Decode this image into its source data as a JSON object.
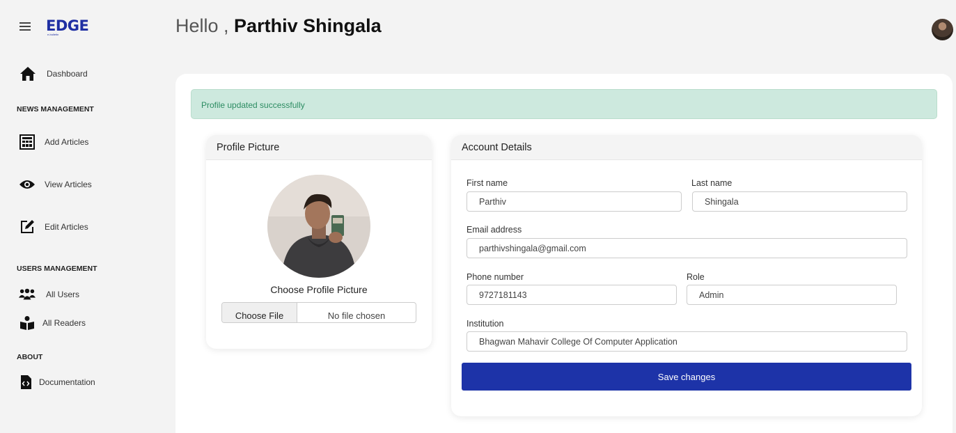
{
  "header": {
    "greeting_prefix": "Hello ,",
    "user_name": "Parthiv Shingala"
  },
  "logo": {
    "text": "EDGE",
    "subtext": "e-bulletin"
  },
  "sidebar": {
    "dashboard": {
      "label": "Dashboard",
      "icon": "home-icon"
    },
    "sections": [
      {
        "title": "NEWS MANAGEMENT"
      },
      {
        "title": "USERS MANAGEMENT"
      },
      {
        "title": "ABOUT"
      }
    ],
    "items": [
      {
        "label": "Add Articles",
        "icon": "newspaper-icon"
      },
      {
        "label": "View Articles",
        "icon": "eye-icon"
      },
      {
        "label": "Edit Articles",
        "icon": "edit-icon"
      },
      {
        "label": "All Users",
        "icon": "users-icon"
      },
      {
        "label": "All Readers",
        "icon": "reader-icon"
      },
      {
        "label": "Documentation",
        "icon": "code-file-icon"
      }
    ]
  },
  "alert": {
    "message": "Profile updated successfully"
  },
  "profile_picture": {
    "title": "Profile Picture",
    "caption": "Choose Profile Picture",
    "file_button": "Choose File",
    "file_status": "No file chosen"
  },
  "account": {
    "title": "Account Details",
    "first_name_label": "First name",
    "first_name": "Parthiv",
    "last_name_label": "Last name",
    "last_name": "Shingala",
    "email_label": "Email address",
    "email": "parthivshingala@gmail.com",
    "phone_label": "Phone number",
    "phone": "9727181143",
    "role_label": "Role",
    "role": "Admin",
    "institution_label": "Institution",
    "institution": "Bhagwan Mahavir College Of Computer Application",
    "save_label": "Save changes"
  },
  "colors": {
    "brand": "#1f2fa3",
    "primary_button": "#1d33a8",
    "alert_bg": "#cde9de",
    "alert_text": "#2c8c62"
  }
}
